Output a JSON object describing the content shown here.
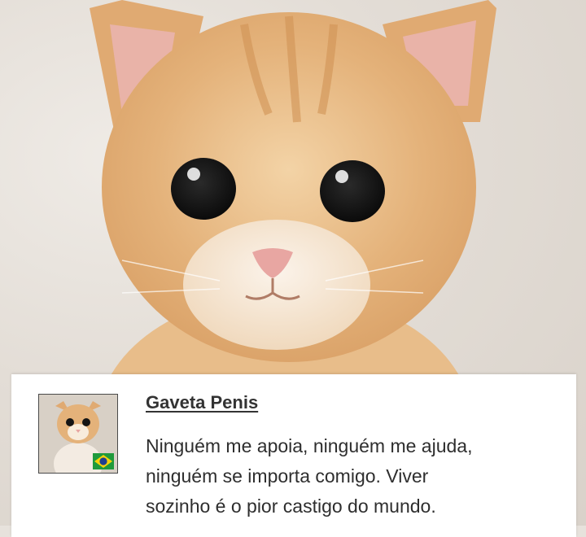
{
  "post": {
    "author": "Gaveta Penis",
    "lines": [
      "Ninguém me apoia, ninguém me ajuda,",
      "ninguém se importa comigo. Viver",
      "sozinho é o pior castigo do mundo."
    ]
  },
  "photo": {
    "subject": "kitten-photo",
    "fur_color": "#e4b27a",
    "fur_light": "#f2d8b6",
    "eye_color": "#141414",
    "nose_color": "#e8a6a2",
    "background_color": "#e6e1da"
  },
  "avatar": {
    "flag_icon": "brazil-flag-icon",
    "flag_green": "#1f9a3c",
    "flag_yellow": "#f5d20a",
    "flag_blue": "#1f3f8f"
  }
}
